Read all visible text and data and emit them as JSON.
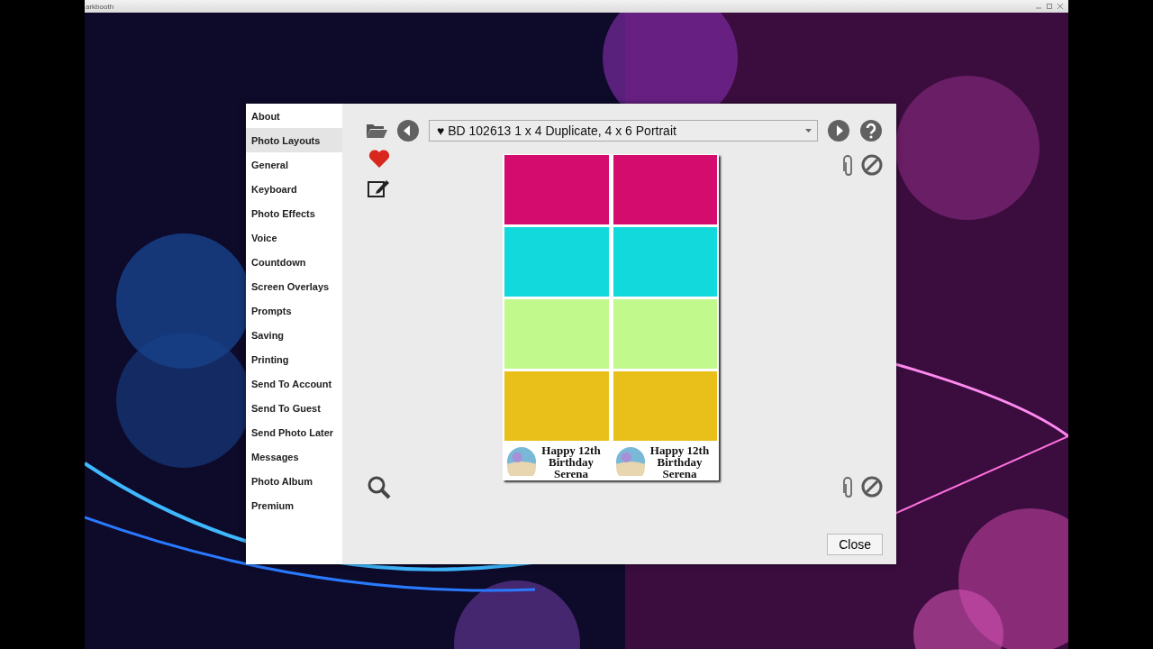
{
  "window": {
    "title": "arkbooth"
  },
  "sidebar": {
    "items": [
      {
        "label": "About",
        "selected": false
      },
      {
        "label": "Photo Layouts",
        "selected": true
      },
      {
        "label": "General",
        "selected": false
      },
      {
        "label": "Keyboard",
        "selected": false
      },
      {
        "label": "Photo Effects",
        "selected": false
      },
      {
        "label": "Voice",
        "selected": false
      },
      {
        "label": "Countdown",
        "selected": false
      },
      {
        "label": "Screen Overlays",
        "selected": false
      },
      {
        "label": "Prompts",
        "selected": false
      },
      {
        "label": "Saving",
        "selected": false
      },
      {
        "label": "Printing",
        "selected": false
      },
      {
        "label": "Send To Account",
        "selected": false
      },
      {
        "label": "Send To Guest",
        "selected": false
      },
      {
        "label": "Send Photo Later",
        "selected": false
      },
      {
        "label": "Messages",
        "selected": false
      },
      {
        "label": "Photo Album",
        "selected": false
      },
      {
        "label": "Premium",
        "selected": false
      }
    ]
  },
  "layout_selector": {
    "value": "♥ BD 102613 1 x 4 Duplicate, 4 x 6 Portrait"
  },
  "strip": {
    "rows": [
      {
        "color": "#d40c6e"
      },
      {
        "color": "#12d9dc"
      },
      {
        "color": "#c2f98c"
      },
      {
        "color": "#e8c019"
      }
    ],
    "captions": [
      {
        "text": "Happy 12th Birthday Serena"
      },
      {
        "text": "Happy 12th Birthday Serena"
      }
    ]
  },
  "close_button": {
    "label": "Close"
  }
}
